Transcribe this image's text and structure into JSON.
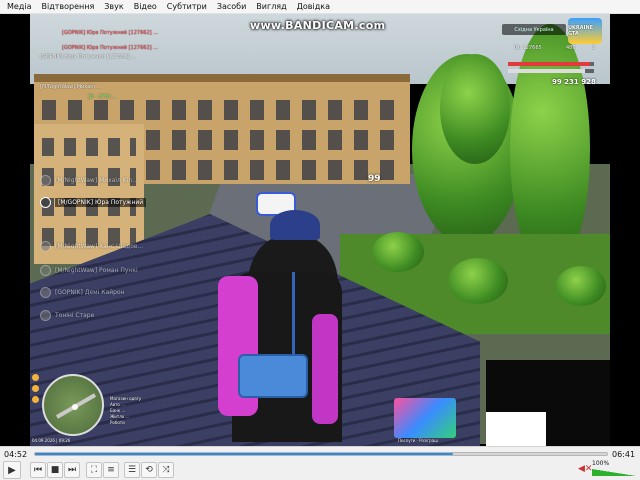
{
  "menu": [
    "Медіа",
    "Відтворення",
    "Звук",
    "Відео",
    "Субтитри",
    "Засоби",
    "Вигляд",
    "Довідка"
  ],
  "watermark": "www.BANDICAM.com",
  "chat": [
    {
      "text": "[GOPNIK] Юра Потужний [127662] ...",
      "color": "red"
    },
    {
      "text": "[GOPNIK] Юра Потужний [127662] ...",
      "color": "red"
    },
    {
      "text": "[GOPNIK] Юра Потужний [127662] ...",
      "color": "white"
    },
    {
      "text": "[M/NightWaw] Михаїл ...",
      "color": "white"
    },
    {
      "text": "[D - 575] ...",
      "color": "green"
    }
  ],
  "voice": [
    {
      "name": "[M/NightWaw] Михаїл Kin...",
      "state": "faded"
    },
    {
      "name": "[M/GOPNIK] Юра Потужний",
      "state": "active"
    },
    {
      "name": "[M/NightWaw] Ханс Шадов...",
      "state": "faded"
    },
    {
      "name": "[M/NightWaw] Роман Пункі",
      "state": "faded"
    },
    {
      "name": "[GOPNIK] Демі Кайрон",
      "state": "faded"
    },
    {
      "name": "Тоніні Старе",
      "state": "faded"
    }
  ],
  "hud": {
    "server": "Східна Україна",
    "logo": "UKRAINE GTA",
    "player_id": "ID: 127665",
    "stat1": "486",
    "stat2": "2",
    "money": "99 231 928",
    "wanted": "99",
    "health_color": "#e23b3b",
    "armor_color": "#dddddd"
  },
  "minimap_legend": [
    "Магазин одягу",
    "Авто ...",
    "Банк ...",
    "Житло ...",
    "Роботи"
  ],
  "hud_date": "04.09.2026 | 09:26",
  "promo_text": "Послуги · Розіграш",
  "player": {
    "elapsed": "04:52",
    "total": "06:41",
    "progress": 0.73,
    "volume": "100%",
    "buttons": [
      "play",
      "prev",
      "stop",
      "next",
      "fullscreen",
      "extended",
      "playlist",
      "loop",
      "shuffle"
    ]
  }
}
